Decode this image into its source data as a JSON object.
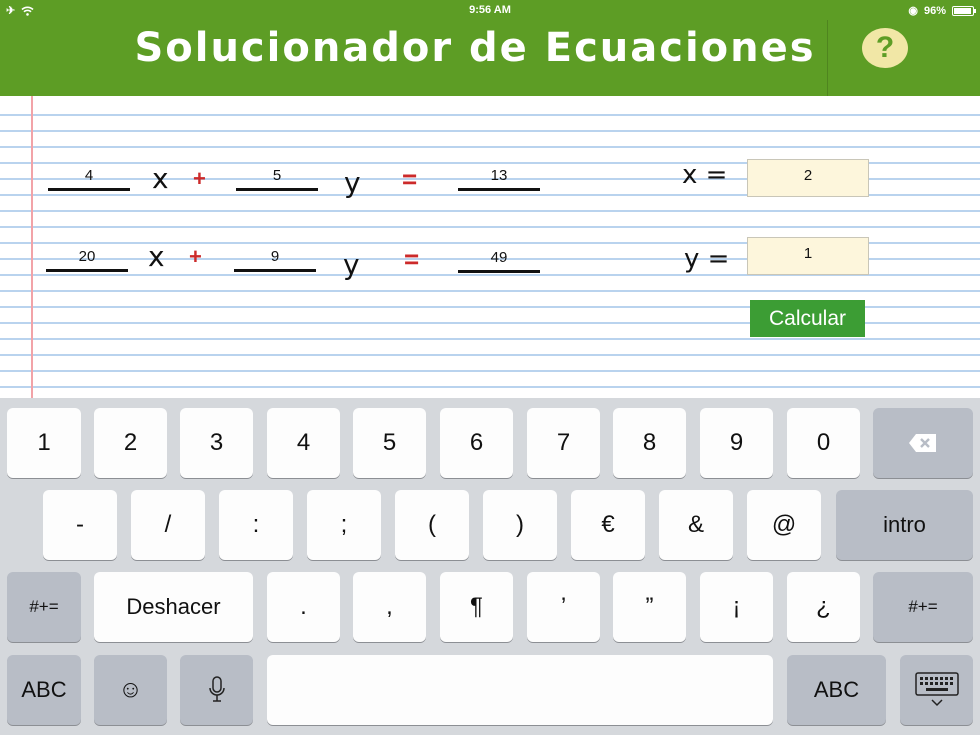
{
  "status": {
    "time": "9:56 AM",
    "battery": "96%"
  },
  "header": {
    "title": "Solucionador de Ecuaciones",
    "help_label": "?"
  },
  "equation1": {
    "a": "4",
    "b": "5",
    "c": "13",
    "x_var": "x",
    "y_var": "y",
    "plus": "+",
    "equals": "="
  },
  "equation2": {
    "a": "20",
    "b": "9",
    "c": "49",
    "x_var": "x",
    "y_var": "y",
    "plus": "+",
    "equals": "="
  },
  "results": {
    "x_label": "x =",
    "x_value": "2",
    "y_label": "y =",
    "y_value": "1"
  },
  "calculate_label": "Calcular",
  "keyboard": {
    "row1": [
      "1",
      "2",
      "3",
      "4",
      "5",
      "6",
      "7",
      "8",
      "9",
      "0"
    ],
    "row2": [
      "-",
      "/",
      ":",
      ";",
      "(",
      ")",
      "€",
      "&",
      "@"
    ],
    "return_label": "intro",
    "symbols_label": "#+=",
    "undo_label": "Deshacer",
    "row3": [
      ".",
      ",",
      "¶",
      "’",
      "”",
      "¡",
      "¿"
    ],
    "abc_label": "ABC"
  },
  "colors": {
    "header": "#5d9d25",
    "accent_red": "#cc2a2a",
    "button": "#3c9d34",
    "result_bg": "#fdf6dc"
  }
}
